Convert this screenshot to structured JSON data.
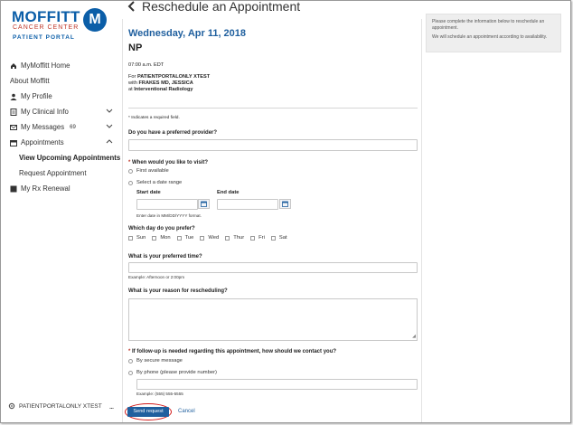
{
  "brand": {
    "name": "MOFFITT",
    "subname": "CANCER CENTER",
    "portal": "PATIENT PORTAL",
    "badge": "M",
    "colors": {
      "primary": "#1f5f9e",
      "accent": "#c0392b",
      "highlight_ring": "#d11a1a"
    }
  },
  "sidebar": {
    "items": [
      {
        "label": "MyMoffitt Home",
        "icon": "home-icon"
      },
      {
        "label": "About Moffitt",
        "icon": ""
      },
      {
        "label": "My Profile",
        "icon": "user-icon"
      },
      {
        "label": "My Clinical Info",
        "icon": "clipboard-icon",
        "chevron": "chevron-down-icon"
      },
      {
        "label": "My Messages",
        "icon": "envelope-icon",
        "count": "69",
        "chevron": "chevron-down-icon"
      },
      {
        "label": "Appointments",
        "icon": "calendar-icon",
        "chevron": "chevron-up-icon"
      },
      {
        "label": "View Upcoming Appointments",
        "active": true
      },
      {
        "label": "Request Appointment"
      },
      {
        "label": "My Rx Renewal",
        "icon": "rx-icon"
      }
    ],
    "user": {
      "name": "PATIENTPORTALONLY XTEST",
      "icon": "gear-icon",
      "more": "..."
    }
  },
  "header": {
    "back_icon": "back-arrow-icon",
    "title": "Reschedule an Appointment"
  },
  "appointment": {
    "date": "Wednesday, Apr 11, 2018",
    "type": "NP",
    "time": "07:00 a.m. EDT",
    "for_prefix": "For ",
    "patient": "PATIENTPORTALONLY XTEST",
    "with_prefix": "with ",
    "provider": "FRAKES MD, JESSICA",
    "at_prefix": "at ",
    "location": "Interventional Radiology"
  },
  "form": {
    "required_note": "* Indicates a required field.",
    "preferred_provider_q": "Do you have a preferred provider?",
    "when_visit_q": "When would you like to visit?",
    "when_options": [
      "First available",
      "Select a date range"
    ],
    "start_date_label": "Start date",
    "end_date_label": "End date",
    "date_hint": "Enter date in MM/DD/YYYY format.",
    "day_q": "Which day do you prefer?",
    "days": [
      "Sun",
      "Mon",
      "Tue",
      "Wed",
      "Thur",
      "Fri",
      "Sat"
    ],
    "time_q": "What is your preferred time?",
    "time_hint": "Example: Afternoon or 2:00pm",
    "reason_q": "What is your reason for rescheduling?",
    "contact_q": "If follow-up is needed regarding this appointment, how should we contact you?",
    "contact_options": [
      "By secure message",
      "By phone (please provide number)"
    ],
    "phone_hint": "Example: (555) 555-5555",
    "send_label": "Send request",
    "cancel_label": "Cancel"
  },
  "info_panel": {
    "line1": "Please complete the information below to reschedule an appointment.",
    "line2": "We will schedule an appointment according to availability."
  }
}
